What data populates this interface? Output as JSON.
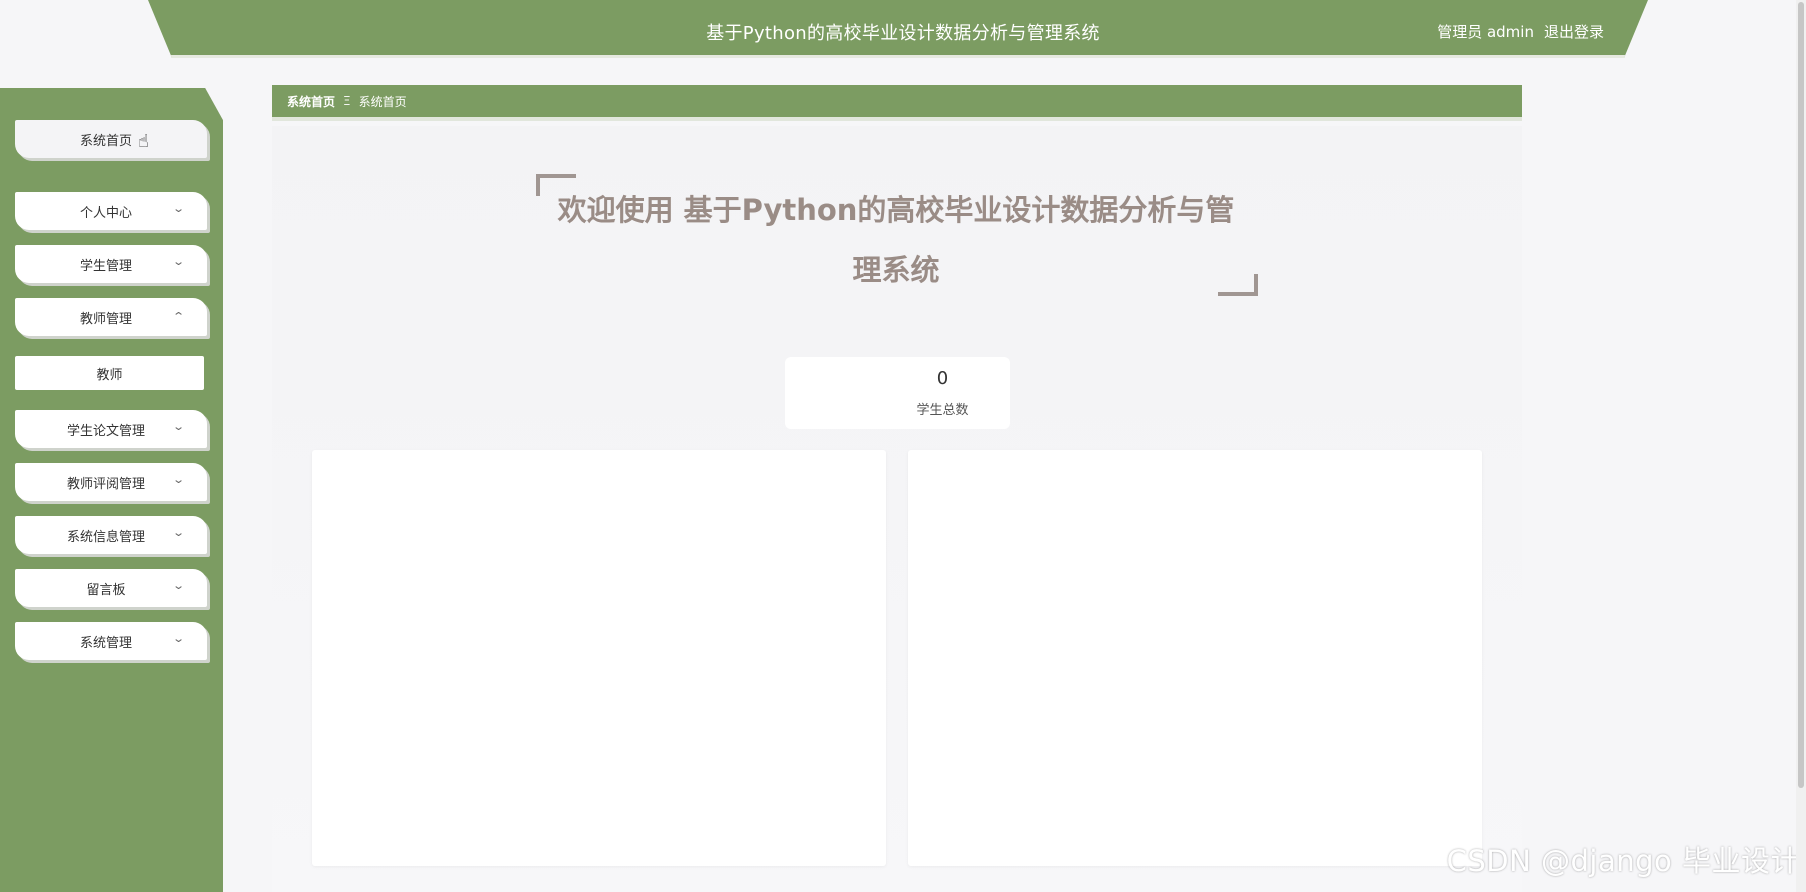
{
  "header": {
    "title": "基于Python的高校毕业设计数据分析与管理系统",
    "user_label": "管理员 admin",
    "logout_label": "退出登录"
  },
  "sidebar": {
    "items": [
      {
        "label": "系统首页",
        "expanded": null
      },
      {
        "label": "个人中心",
        "chevron": "chevron-down"
      },
      {
        "label": "学生管理",
        "chevron": "chevron-down"
      },
      {
        "label": "教师管理",
        "chevron": "chevron-up"
      },
      {
        "label": "学生论文管理",
        "chevron": "chevron-down"
      },
      {
        "label": "教师评阅管理",
        "chevron": "chevron-down"
      },
      {
        "label": "系统信息管理",
        "chevron": "chevron-down"
      },
      {
        "label": "留言板",
        "chevron": "chevron-down"
      },
      {
        "label": "系统管理",
        "chevron": "chevron-down"
      }
    ],
    "sub_items": [
      {
        "label": "教师"
      }
    ]
  },
  "breadcrumb": {
    "items": [
      "系统首页",
      "系统首页"
    ],
    "separator": "Ξ"
  },
  "main": {
    "welcome_line1": "欢迎使用 基于Python的高校毕业设计数据分析与管",
    "welcome_line2": "理系统",
    "stat": {
      "value": "0",
      "label": "学生总数"
    }
  },
  "watermark": "CSDN @django 毕业设计",
  "colors": {
    "brand_green": "#7c9c62",
    "welcome_text": "#9a8c86",
    "background": "#f6f6f8"
  }
}
